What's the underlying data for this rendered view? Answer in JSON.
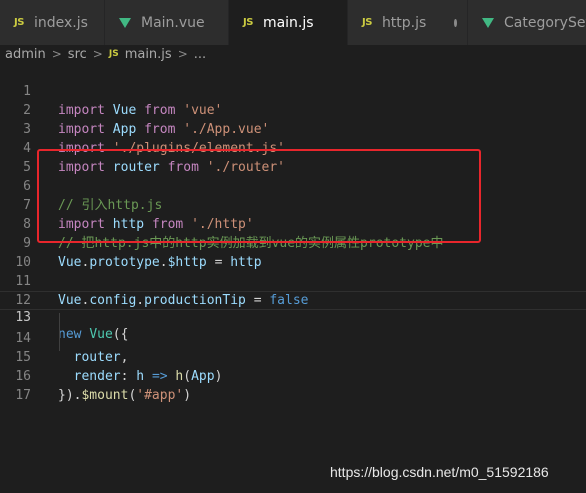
{
  "tabs": [
    {
      "label": "index.js",
      "kind": "js",
      "active": false,
      "modified": false
    },
    {
      "label": "Main.vue",
      "kind": "vue",
      "active": false,
      "modified": false
    },
    {
      "label": "main.js",
      "kind": "js",
      "active": true,
      "modified": true
    },
    {
      "label": "http.js",
      "kind": "js",
      "active": false,
      "modified": true
    },
    {
      "label": "CategorySet.vu",
      "kind": "vue",
      "active": false,
      "modified": false
    }
  ],
  "js_badge": "JS",
  "breadcrumb": {
    "folder1": "admin",
    "folder2": "src",
    "file": "main.js",
    "more": "...",
    "sep": ">"
  },
  "editor": {
    "line_numbers": [
      "1",
      "2",
      "3",
      "4",
      "5",
      "6",
      "7",
      "8",
      "9",
      "10",
      "11",
      "12",
      "13",
      "14",
      "15",
      "16",
      "17"
    ],
    "lines": {
      "l1": {
        "kw": "import",
        "id": "Vue",
        "from": "from",
        "str": "'vue'"
      },
      "l2": {
        "kw": "import",
        "id": "App",
        "from": "from",
        "str": "'./App.vue'"
      },
      "l3": {
        "kw": "import",
        "str": "'./plugins/element.js'"
      },
      "l4": {
        "kw": "import",
        "id": "router",
        "from": "from",
        "str": "'./router'"
      },
      "l6": {
        "comment": "// 引入http.js"
      },
      "l7": {
        "kw": "import",
        "id": "http",
        "from": "from",
        "str": "'./http'"
      },
      "l8": {
        "comment": "// 把http.js中的http实例加载到vue的实例属性prototype中"
      },
      "l9": {
        "a": "Vue",
        "b": "prototype",
        "c": "$http",
        "eq": "=",
        "d": "http"
      },
      "l11": {
        "a": "Vue",
        "b": "config",
        "c": "productionTip",
        "eq": "=",
        "val": "false"
      },
      "l13": {
        "kw": "new",
        "cls": "Vue",
        "open": "({"
      },
      "l14": {
        "id": "router"
      },
      "l15": {
        "id": "render",
        "p": "h",
        "arrow": "=>",
        "fn": "h",
        "arg": "App"
      },
      "l16": {
        "close": "})",
        "fn": "$mount",
        "str": "'#app'"
      }
    }
  },
  "colors": {
    "highlight_box": "#e8262c",
    "js_badge": "#cbcb41",
    "vue_badge": "#41b883"
  },
  "watermark": "https://blog.csdn.net/m0_51592186"
}
